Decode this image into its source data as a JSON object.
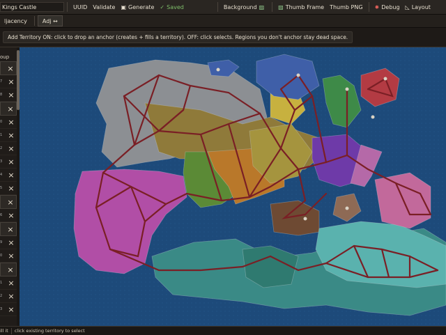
{
  "toolbar": {
    "title_value": "Kings Castle",
    "uuid_label": "UUID",
    "validate_label": "Validate",
    "generate_label": "Generate",
    "saved_label": "Saved",
    "background_label": "Background",
    "thumb_frame_label": "Thumb Frame",
    "thumb_png_label": "Thumb PNG",
    "debug_label": "Debug",
    "layout_label": "Layout"
  },
  "tabs": {
    "adjacency_label": "ljacency",
    "adj_label": "Adj ↔"
  },
  "hint": {
    "text": "Add Territory ON: click to drop an anchor (creates + fills a territory).  OFF: click selects.  Regions you don't anchor stay dead space."
  },
  "sidebar": {
    "header": "oup",
    "rows": [
      "",
      "7",
      "8",
      "",
      "0",
      "1",
      "2",
      "3",
      "4",
      "5",
      "",
      "6",
      "",
      "9",
      "0",
      "",
      "1",
      "2",
      "3"
    ]
  },
  "status": {
    "left": "ill it",
    "right": "click existing territory to select"
  },
  "colors": {
    "ocean": "#1d4a7a",
    "route": "#7a1f25"
  }
}
